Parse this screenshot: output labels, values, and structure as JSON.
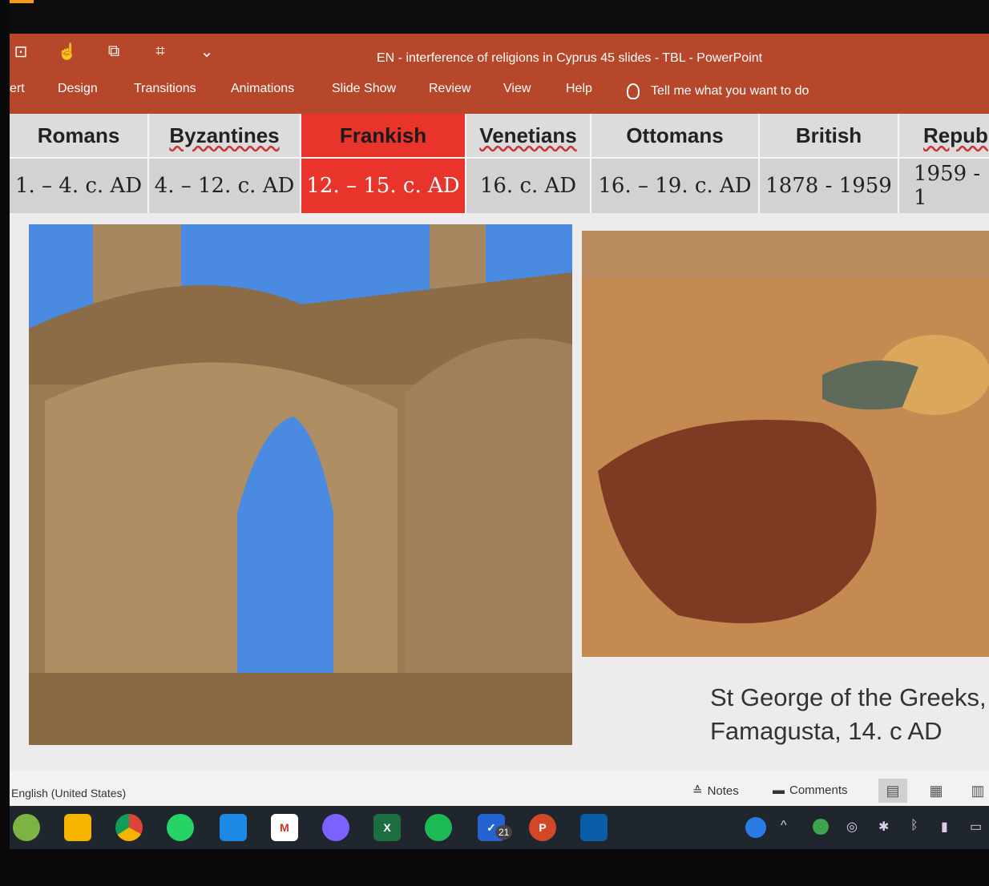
{
  "window": {
    "title": "EN - interference of religions in Cyprus 45 slides - TBL  -  PowerPoint",
    "qat_icons": [
      "autosave-icon",
      "touch-mode-icon",
      "new-slide-icon",
      "screenshot-icon",
      "customize-qat-icon"
    ]
  },
  "ribbon": {
    "tabs": [
      "ert",
      "Design",
      "Transitions",
      "Animations",
      "Slide Show",
      "Review",
      "View",
      "Help"
    ],
    "tell_me": "Tell me what you want to do"
  },
  "slide": {
    "periods": [
      {
        "name": "Romans",
        "dates": "1. – 4. c. AD",
        "active": false
      },
      {
        "name": "Byzantines",
        "dates": "4. – 12. c. AD",
        "active": false
      },
      {
        "name": "Frankish",
        "dates": "12. – 15. c. AD",
        "active": true
      },
      {
        "name": "Venetians",
        "dates": "16. c. AD",
        "active": false
      },
      {
        "name": "Ottomans",
        "dates": "16. – 19. c. AD",
        "active": false
      },
      {
        "name": "British",
        "dates": "1878 - 1959",
        "active": false
      },
      {
        "name": "Repub",
        "dates": "1959 - 1",
        "active": false
      }
    ],
    "caption_line1": "St George of the Greeks,",
    "caption_line2": "Famagusta, 14. c AD"
  },
  "statusbar": {
    "language": "English (United States)",
    "notes": "Notes",
    "comments": "Comments"
  },
  "taskbar": {
    "apps": [
      "android-app-icon",
      "file-explorer-icon",
      "chrome-icon",
      "whatsapp-icon",
      "onedrive-icon",
      "gmail-icon",
      "messenger-icon",
      "excel-icon",
      "spotify-icon",
      "todo-icon",
      "powerpoint-icon",
      "photos-icon"
    ],
    "todo_badge": "21"
  },
  "colors": {
    "ribbon": "#b7472a",
    "highlight": "#e8342b",
    "taskbar": "#20262d"
  }
}
